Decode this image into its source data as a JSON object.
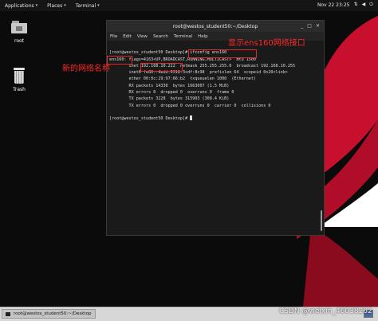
{
  "topbar": {
    "applications": "Applications",
    "places": "Places",
    "terminal": "Terminal",
    "clock": "Nov 22  23:25"
  },
  "desktop": {
    "icons": [
      {
        "label": "root",
        "icon": "home-folder-icon"
      },
      {
        "label": "Trash",
        "icon": "trash-icon"
      }
    ]
  },
  "terminal": {
    "title": "root@westos_student50:~/Desktop",
    "menu": [
      "File",
      "Edit",
      "View",
      "Search",
      "Terminal",
      "Help"
    ],
    "lines": [
      "[root@westos_student50 Desktop]# ifconfig ens160",
      "ens160: flags=4163<UP,BROADCAST,RUNNING,MULTICAST>  mtu 1500",
      "        inet 192.168.10.222  netmask 255.255.255.0  broadcast 192.168.10.255",
      "        inet6 fe80::4edd:9318:3cdf:8c98  prefixlen 64  scopeid 0x20<link>",
      "        ether 00:0c:29:97:66:b2  txqueuelen 1000  (Ethernet)",
      "        RX packets 14330  bytes 1663007 (1.5 MiB)",
      "        RX errors 0  dropped 0  overruns 0  frame 0",
      "        TX packets 3228  bytes 315903 (308.4 KiB)",
      "        TX errors 0  dropped 0 overruns 0  carrier 0  collisions 0",
      "",
      "[root@westos_student50 Desktop]# "
    ]
  },
  "annotations": {
    "show_interface": "显示ens160网络接口",
    "new_name": "新的网络名称"
  },
  "taskbar": {
    "item": "root@westos_student50:~/Desktop"
  },
  "watermark": "CSDN @weixin_46038262",
  "colors": {
    "annotation_red": "#e0282a",
    "swoosh_red": "#c8102e"
  }
}
